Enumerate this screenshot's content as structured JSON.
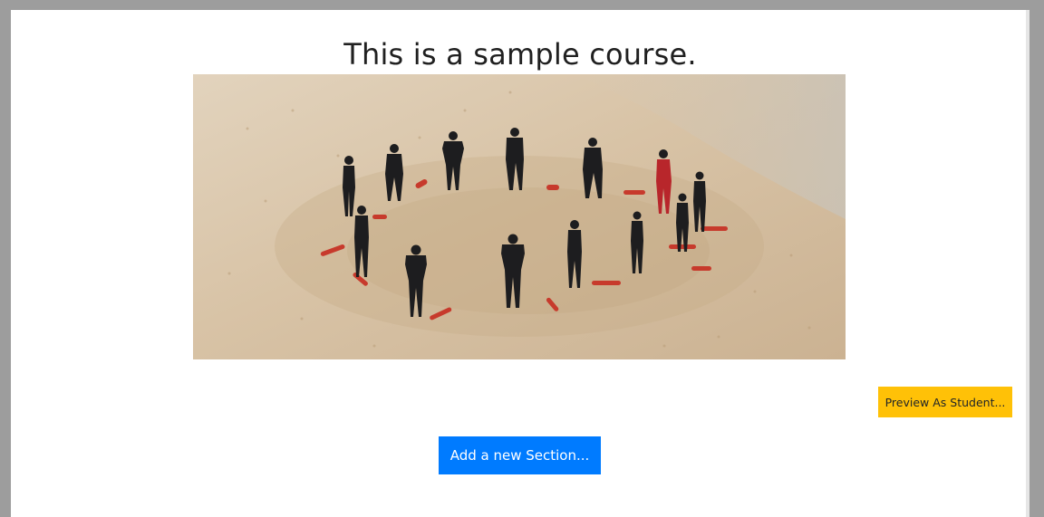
{
  "course": {
    "title": "This is a sample course.",
    "banner_image_alt": "Group of lifeguards in wetsuits standing in a circle on sand"
  },
  "actions": {
    "preview_label": "Preview As Student...",
    "add_section_label": "Add a new Section..."
  },
  "colors": {
    "preview_button": "#ffc107",
    "add_section_button": "#007bff",
    "page_background": "#ffffff",
    "outer_background": "#9d9d9d"
  }
}
